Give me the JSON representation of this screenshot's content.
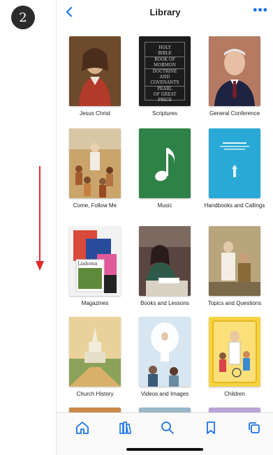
{
  "step": {
    "number": "2"
  },
  "navbar": {
    "title": "Library",
    "more": "•••"
  },
  "cover_text": {
    "scriptures": [
      "HOLY",
      "BIBLE",
      "BOOK OF",
      "MORMON",
      "DOCTRINE",
      "AND",
      "COVENANTS",
      "PEARL",
      "OF GREAT",
      "PRICE"
    ],
    "magazine": "Liahona"
  },
  "tiles": [
    {
      "label": "Jesus Christ"
    },
    {
      "label": "Scriptures"
    },
    {
      "label": "General Conference"
    },
    {
      "label": "Come, Follow Me"
    },
    {
      "label": "Music"
    },
    {
      "label": "Handbooks and Callings"
    },
    {
      "label": "Magazines"
    },
    {
      "label": "Books and Lessons"
    },
    {
      "label": "Topics and Questions"
    },
    {
      "label": "Church History"
    },
    {
      "label": "Videos and Images"
    },
    {
      "label": "Children"
    }
  ],
  "colors": {
    "accent": "#1a73e8",
    "arrow": "#e02b2b"
  }
}
